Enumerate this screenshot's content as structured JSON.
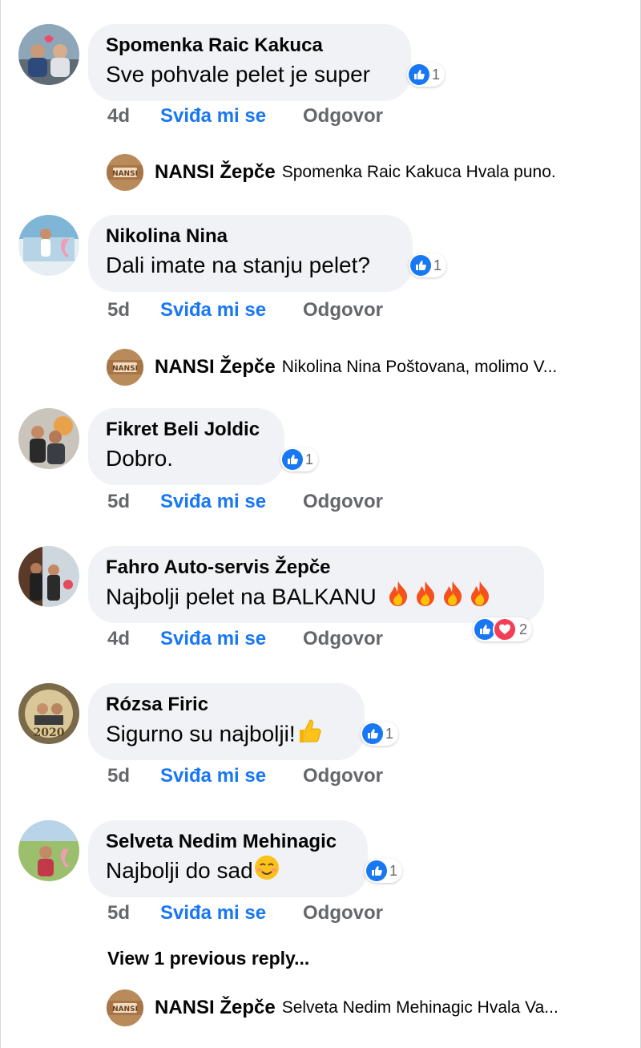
{
  "comments": [
    {
      "author": "Spomenka Raic Kakuca",
      "text": "Sve pohvale pelet je super",
      "time": "4d",
      "like_label": "Sviđa mi se",
      "reply_label": "Odgovor",
      "reaction_count": "1",
      "reactions": [
        "like-icon"
      ],
      "reply": {
        "author": "NANSI Žepče",
        "text": "Spomenka Raic Kakuca  Hvala puno."
      }
    },
    {
      "author": "Nikolina Nina",
      "text": "Dali imate na stanju pelet?",
      "time": "5d",
      "like_label": "Sviđa mi se",
      "reply_label": "Odgovor",
      "reaction_count": "1",
      "reactions": [
        "like-icon"
      ],
      "reply": {
        "author": "NANSI Žepče",
        "text": "Nikolina Nina Poštovana, molimo V..."
      }
    },
    {
      "author": "Fikret Beli Joldic",
      "text": "Dobro.",
      "time": "5d",
      "like_label": "Sviđa mi se",
      "reply_label": "Odgovor",
      "reaction_count": "1",
      "reactions": [
        "like-icon"
      ]
    },
    {
      "author": "Fahro Auto-servis Žepče",
      "text": "Najbolji pelet na BALKANU",
      "emojis": [
        "fire-emoji",
        "fire-emoji",
        "fire-emoji",
        "fire-emoji"
      ],
      "time": "4d",
      "like_label": "Sviđa mi se",
      "reply_label": "Odgovor",
      "reaction_count": "2",
      "reactions": [
        "like-icon",
        "love-icon"
      ]
    },
    {
      "author": "Rózsa Firic",
      "text": "Sigurno su najbolji!",
      "emojis": [
        "thumbs-up-emoji"
      ],
      "time": "5d",
      "like_label": "Sviđa mi se",
      "reply_label": "Odgovor",
      "reaction_count": "1",
      "reactions": [
        "like-icon"
      ]
    },
    {
      "author": "Selveta Nedim Mehinagic",
      "text": "Najbolji do sad",
      "emojis": [
        "smiling-face-emoji"
      ],
      "time": "5d",
      "like_label": "Sviđa mi se",
      "reply_label": "Odgovor",
      "reaction_count": "1",
      "reactions": [
        "like-icon"
      ],
      "view_previous": "View 1 previous reply...",
      "reply": {
        "author": "NANSI Žepče",
        "text": "Selveta Nedim Mehinagic Hvala Va..."
      }
    }
  ],
  "colors": {
    "bubble": "#f0f2f5",
    "like_blue": "#1877f2",
    "love_red": "#f33e58",
    "meta_gray": "#65676b"
  }
}
